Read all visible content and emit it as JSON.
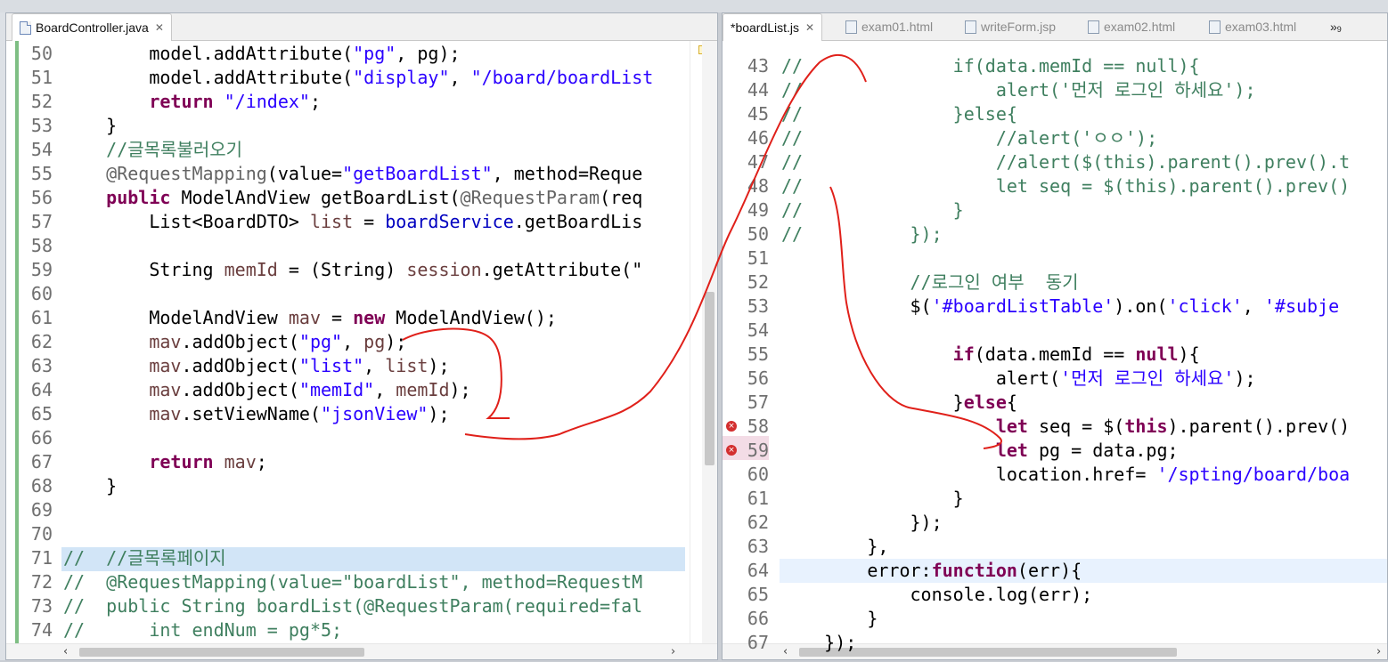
{
  "left_editor": {
    "tabs": [
      {
        "label": "BoardController.java",
        "active": true
      }
    ],
    "lines": [
      {
        "n": "50",
        "tokens": [
          [
            "",
            "    "
          ],
          [
            "plain",
            "    model.addAttribute("
          ],
          [
            "str",
            "\"pg\""
          ],
          [
            "plain",
            ", pg);"
          ]
        ]
      },
      {
        "n": "51",
        "tokens": [
          [
            "plain",
            "        model.addAttribute("
          ],
          [
            "str",
            "\"display\""
          ],
          [
            "plain",
            ", "
          ],
          [
            "str",
            "\"/board/boardList"
          ]
        ]
      },
      {
        "n": "52",
        "tokens": [
          [
            "plain",
            "        "
          ],
          [
            "kw",
            "return"
          ],
          [
            "plain",
            " "
          ],
          [
            "str",
            "\"/index\""
          ],
          [
            "plain",
            ";"
          ]
        ]
      },
      {
        "n": "53",
        "tokens": [
          [
            "plain",
            "    }"
          ]
        ]
      },
      {
        "n": "54",
        "tokens": [
          [
            "plain",
            "    "
          ],
          [
            "cmt",
            "//글목록불러오기"
          ]
        ]
      },
      {
        "n": "55",
        "tokens": [
          [
            "plain",
            "    "
          ],
          [
            "ann",
            "@RequestMapping"
          ],
          [
            "plain",
            "(value="
          ],
          [
            "str",
            "\"getBoardList\""
          ],
          [
            "plain",
            ", method=Reque"
          ]
        ]
      },
      {
        "n": "56",
        "tokens": [
          [
            "plain",
            "    "
          ],
          [
            "kw",
            "public"
          ],
          [
            "plain",
            " ModelAndView getBoardList("
          ],
          [
            "ann",
            "@RequestParam"
          ],
          [
            "plain",
            "(req"
          ]
        ]
      },
      {
        "n": "57",
        "tokens": [
          [
            "plain",
            "        List<BoardDTO> "
          ],
          [
            "var",
            "list"
          ],
          [
            "plain",
            " = "
          ],
          [
            "fld",
            "boardService"
          ],
          [
            "plain",
            ".getBoardLis"
          ]
        ]
      },
      {
        "n": "58",
        "tokens": []
      },
      {
        "n": "59",
        "tokens": [
          [
            "plain",
            "        String "
          ],
          [
            "var",
            "memId"
          ],
          [
            "plain",
            " = (String) "
          ],
          [
            "var",
            "session"
          ],
          [
            "plain",
            ".getAttribute(\""
          ]
        ]
      },
      {
        "n": "60",
        "tokens": []
      },
      {
        "n": "61",
        "tokens": [
          [
            "plain",
            "        ModelAndView "
          ],
          [
            "var",
            "mav"
          ],
          [
            "plain",
            " = "
          ],
          [
            "kw",
            "new"
          ],
          [
            "plain",
            " ModelAndView();"
          ]
        ]
      },
      {
        "n": "62",
        "tokens": [
          [
            "plain",
            "        "
          ],
          [
            "var",
            "mav"
          ],
          [
            "plain",
            ".addObject("
          ],
          [
            "str",
            "\"pg\""
          ],
          [
            "plain",
            ", "
          ],
          [
            "var",
            "pg"
          ],
          [
            "plain",
            ");"
          ]
        ]
      },
      {
        "n": "63",
        "tokens": [
          [
            "plain",
            "        "
          ],
          [
            "var",
            "mav"
          ],
          [
            "plain",
            ".addObject("
          ],
          [
            "str",
            "\"list\""
          ],
          [
            "plain",
            ", "
          ],
          [
            "var",
            "list"
          ],
          [
            "plain",
            ");"
          ]
        ]
      },
      {
        "n": "64",
        "tokens": [
          [
            "plain",
            "        "
          ],
          [
            "var",
            "mav"
          ],
          [
            "plain",
            ".addObject("
          ],
          [
            "str",
            "\"memId\""
          ],
          [
            "plain",
            ", "
          ],
          [
            "var",
            "memId"
          ],
          [
            "plain",
            ");"
          ]
        ]
      },
      {
        "n": "65",
        "tokens": [
          [
            "plain",
            "        "
          ],
          [
            "var",
            "mav"
          ],
          [
            "plain",
            ".setViewName("
          ],
          [
            "str",
            "\"jsonView\""
          ],
          [
            "plain",
            ");"
          ]
        ]
      },
      {
        "n": "66",
        "tokens": []
      },
      {
        "n": "67",
        "tokens": [
          [
            "plain",
            "        "
          ],
          [
            "kw",
            "return"
          ],
          [
            "plain",
            " "
          ],
          [
            "var",
            "mav"
          ],
          [
            "plain",
            ";"
          ]
        ]
      },
      {
        "n": "68",
        "tokens": [
          [
            "plain",
            "    }"
          ]
        ]
      },
      {
        "n": "69",
        "tokens": []
      },
      {
        "n": "70",
        "tokens": []
      },
      {
        "n": "71",
        "tokens": [
          [
            "cmt",
            "//  //글목록페이지"
          ]
        ]
      },
      {
        "n": "72",
        "tokens": [
          [
            "cmt",
            "//  @RequestMapping(value=\"boardList\", method=RequestM"
          ]
        ]
      },
      {
        "n": "73",
        "tokens": [
          [
            "cmt",
            "//  public String boardList(@RequestParam(required=fal"
          ]
        ]
      },
      {
        "n": "74",
        "tokens": [
          [
            "cmt",
            "//      int endNum = pg*5;"
          ]
        ]
      }
    ]
  },
  "right_editor": {
    "tabs": [
      {
        "label": "*boardList.js",
        "active": true
      },
      {
        "label": "exam01.html",
        "active": false
      },
      {
        "label": "writeForm.jsp",
        "active": false
      },
      {
        "label": "exam02.html",
        "active": false
      },
      {
        "label": "exam03.html",
        "active": false
      }
    ],
    "overflow_label": "»",
    "overflow_count": "9",
    "lines": [
      {
        "n": "43",
        "tokens": [
          [
            "cmt",
            "//              if(data.memId == null){"
          ]
        ]
      },
      {
        "n": "44",
        "tokens": [
          [
            "cmt",
            "//                  alert('먼저 로그인 하세요');"
          ]
        ]
      },
      {
        "n": "45",
        "tokens": [
          [
            "cmt",
            "//              }else{"
          ]
        ]
      },
      {
        "n": "46",
        "tokens": [
          [
            "cmt",
            "//                  //alert('ㅇㅇ');"
          ]
        ]
      },
      {
        "n": "47",
        "tokens": [
          [
            "cmt",
            "//                  //alert($(this).parent().prev().t"
          ]
        ]
      },
      {
        "n": "48",
        "tokens": [
          [
            "cmt",
            "//                  let seq = $(this).parent().prev()"
          ]
        ]
      },
      {
        "n": "49",
        "tokens": [
          [
            "cmt",
            "//              }"
          ]
        ]
      },
      {
        "n": "50",
        "tokens": [
          [
            "cmt",
            "//          });"
          ]
        ]
      },
      {
        "n": "51",
        "tokens": []
      },
      {
        "n": "52",
        "tokens": [
          [
            "plain",
            "            "
          ],
          [
            "cmt",
            "//로그인 여부  동기"
          ]
        ]
      },
      {
        "n": "53",
        "tokens": [
          [
            "plain",
            "            $("
          ],
          [
            "str",
            "'#boardListTable'"
          ],
          [
            "plain",
            ").on("
          ],
          [
            "str",
            "'click'"
          ],
          [
            "plain",
            ", "
          ],
          [
            "str",
            "'#subje"
          ]
        ]
      },
      {
        "n": "54",
        "tokens": []
      },
      {
        "n": "55",
        "tokens": [
          [
            "plain",
            "                "
          ],
          [
            "kw",
            "if"
          ],
          [
            "plain",
            "(data.memId == "
          ],
          [
            "kw",
            "null"
          ],
          [
            "plain",
            "){"
          ]
        ]
      },
      {
        "n": "56",
        "tokens": [
          [
            "plain",
            "                    alert("
          ],
          [
            "str",
            "'먼저 로그인 하세요'"
          ],
          [
            "plain",
            ");"
          ]
        ]
      },
      {
        "n": "57",
        "tokens": [
          [
            "plain",
            "                }"
          ],
          [
            "kw",
            "else"
          ],
          [
            "plain",
            "{"
          ]
        ]
      },
      {
        "n": "58",
        "tokens": [
          [
            "plain",
            "                    "
          ],
          [
            "kw",
            "let"
          ],
          [
            "plain",
            " seq = $("
          ],
          [
            "kw",
            "this"
          ],
          [
            "plain",
            ").parent().prev()"
          ]
        ]
      },
      {
        "n": "59",
        "tokens": [
          [
            "plain",
            "                    "
          ],
          [
            "kw",
            "let"
          ],
          [
            "plain",
            " pg = data.pg;"
          ]
        ]
      },
      {
        "n": "60",
        "tokens": [
          [
            "plain",
            "                    location.href= "
          ],
          [
            "str",
            "'/spting/board/boa"
          ]
        ]
      },
      {
        "n": "61",
        "tokens": [
          [
            "plain",
            "                }"
          ]
        ]
      },
      {
        "n": "62",
        "tokens": [
          [
            "plain",
            "            });"
          ]
        ]
      },
      {
        "n": "63",
        "tokens": [
          [
            "plain",
            "        },"
          ]
        ]
      },
      {
        "n": "64",
        "tokens": [
          [
            "plain",
            "        error:"
          ],
          [
            "kw",
            "function"
          ],
          [
            "plain",
            "(err){"
          ]
        ]
      },
      {
        "n": "65",
        "tokens": [
          [
            "plain",
            "            console.log(err);"
          ]
        ]
      },
      {
        "n": "66",
        "tokens": [
          [
            "plain",
            "        }"
          ]
        ]
      },
      {
        "n": "67",
        "tokens": [
          [
            "plain",
            "    });"
          ]
        ]
      }
    ],
    "error_lines": [
      "58",
      "59"
    ]
  },
  "colors": {
    "keyword": "#7f0055",
    "string": "#2a00ff",
    "comment": "#3f7f5f",
    "annotation": "#646464",
    "field": "#0000c0",
    "annotation_ink": "#e0201a"
  }
}
